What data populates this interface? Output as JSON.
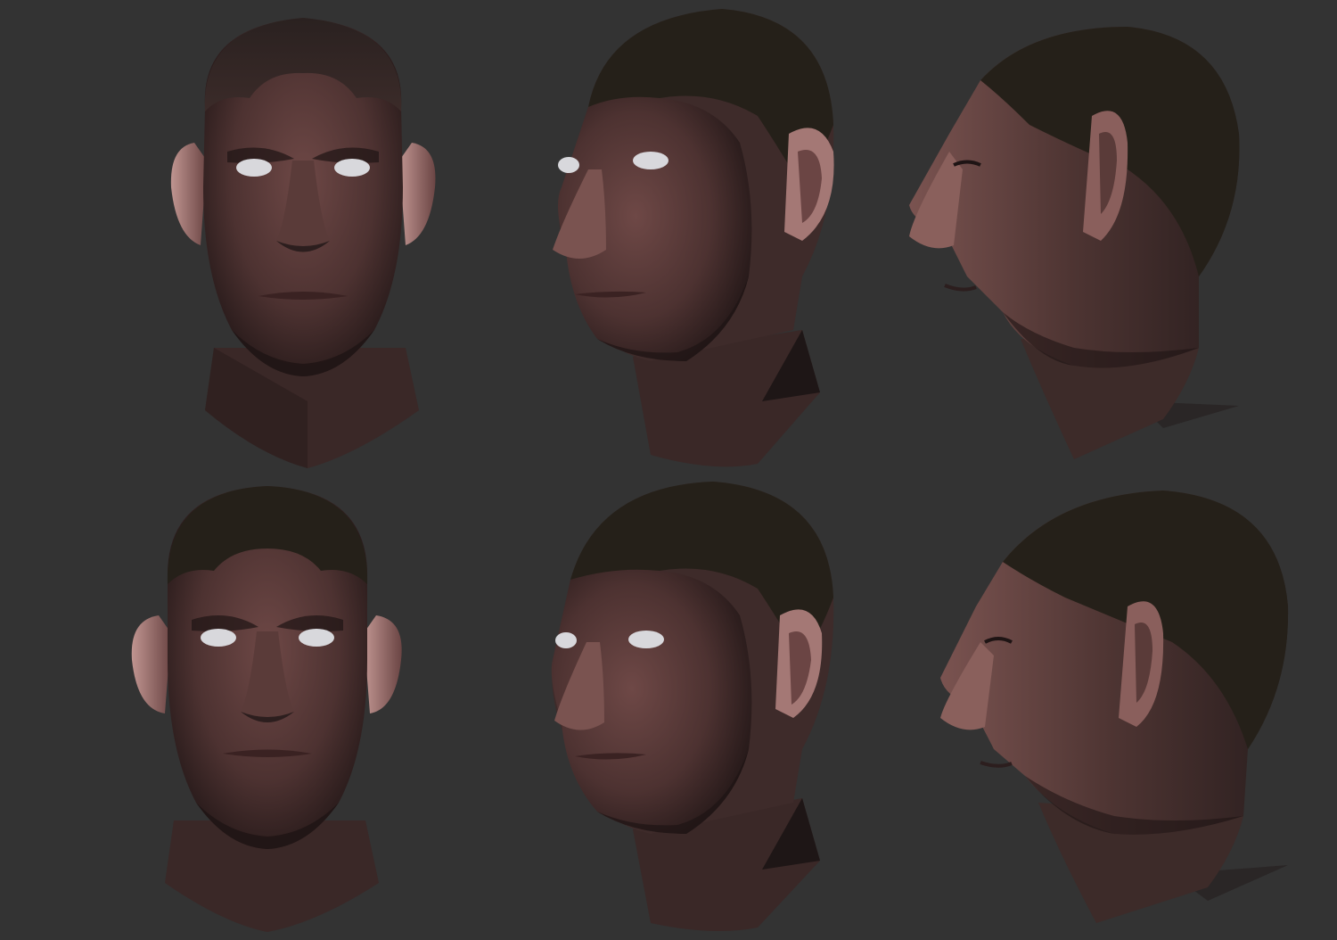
{
  "sheet": {
    "background": "#333333"
  },
  "palette": {
    "skin_light": "#7a5350",
    "skin_mid": "#5a3a38",
    "skin_dark": "#2e1f1f",
    "hair": "#241c1b",
    "eye_white": "#d8d8dc",
    "ear_light": "#b58a86",
    "neck_shadow": "#1e1616",
    "shirt": "#2a2626"
  },
  "renders": [
    {
      "row": "top",
      "angle": "front",
      "eyes_open": true
    },
    {
      "row": "top",
      "angle": "three-quarter-left",
      "eyes_open": true
    },
    {
      "row": "top",
      "angle": "profile-left",
      "eyes_open": false
    },
    {
      "row": "bottom",
      "angle": "front",
      "eyes_open": true
    },
    {
      "row": "bottom",
      "angle": "three-quarter-left",
      "eyes_open": true
    },
    {
      "row": "bottom",
      "angle": "profile-left",
      "eyes_open": false
    }
  ]
}
